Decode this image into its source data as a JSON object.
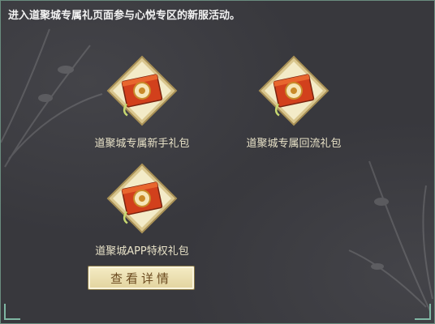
{
  "description": "进入道聚城专属礼页面参与心悦专区的新服活动。",
  "gifts": [
    {
      "label": "道聚城专属新手礼包",
      "icon": "gift-box-icon"
    },
    {
      "label": "道聚城专属回流礼包",
      "icon": "gift-box-icon"
    },
    {
      "label": "道聚城APP特权礼包",
      "icon": "gift-box-icon"
    }
  ],
  "detail_button": {
    "label": "查看详情"
  },
  "colors": {
    "background": "#38383d",
    "border": "#6a8c7f",
    "frame_gold": "#c9b47a",
    "box_red": "#d2401c",
    "button_face": "#efe3b3",
    "button_text": "#6b4a1e"
  }
}
